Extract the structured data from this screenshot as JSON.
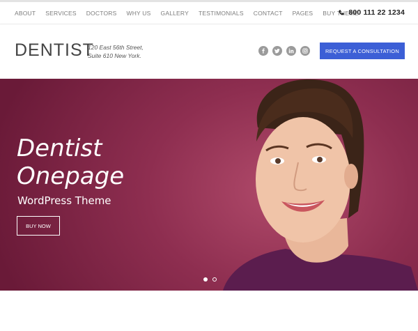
{
  "topnav": {
    "items": [
      {
        "label": "ABOUT"
      },
      {
        "label": "SERVICES"
      },
      {
        "label": "DOCTORS"
      },
      {
        "label": "WHY US"
      },
      {
        "label": "GALLERY"
      },
      {
        "label": "TESTIMONIALS"
      },
      {
        "label": "CONTACT"
      },
      {
        "label": "PAGES"
      },
      {
        "label": "BUY THEME"
      }
    ],
    "phone": "800 111 22 1234",
    "phone_icon": "phone-icon"
  },
  "header": {
    "logo": "DENTIST",
    "address_line1": "120 East 56th Street,",
    "address_line2": "Suite 610 New York.",
    "socials": [
      "facebook-icon",
      "twitter-icon",
      "linkedin-icon",
      "instagram-icon"
    ],
    "cta_label": "REQUEST A CONSULTATION"
  },
  "hero": {
    "title_line1": "Dentist",
    "title_line2": "Onepage",
    "subtitle": "WordPress Theme",
    "button_label": "BUY NOW",
    "slides": 2,
    "active_slide": 1
  },
  "colors": {
    "accent": "#3c5fd6",
    "hero_bg": "#8e2e50",
    "nav_text": "#7d7d7d"
  }
}
